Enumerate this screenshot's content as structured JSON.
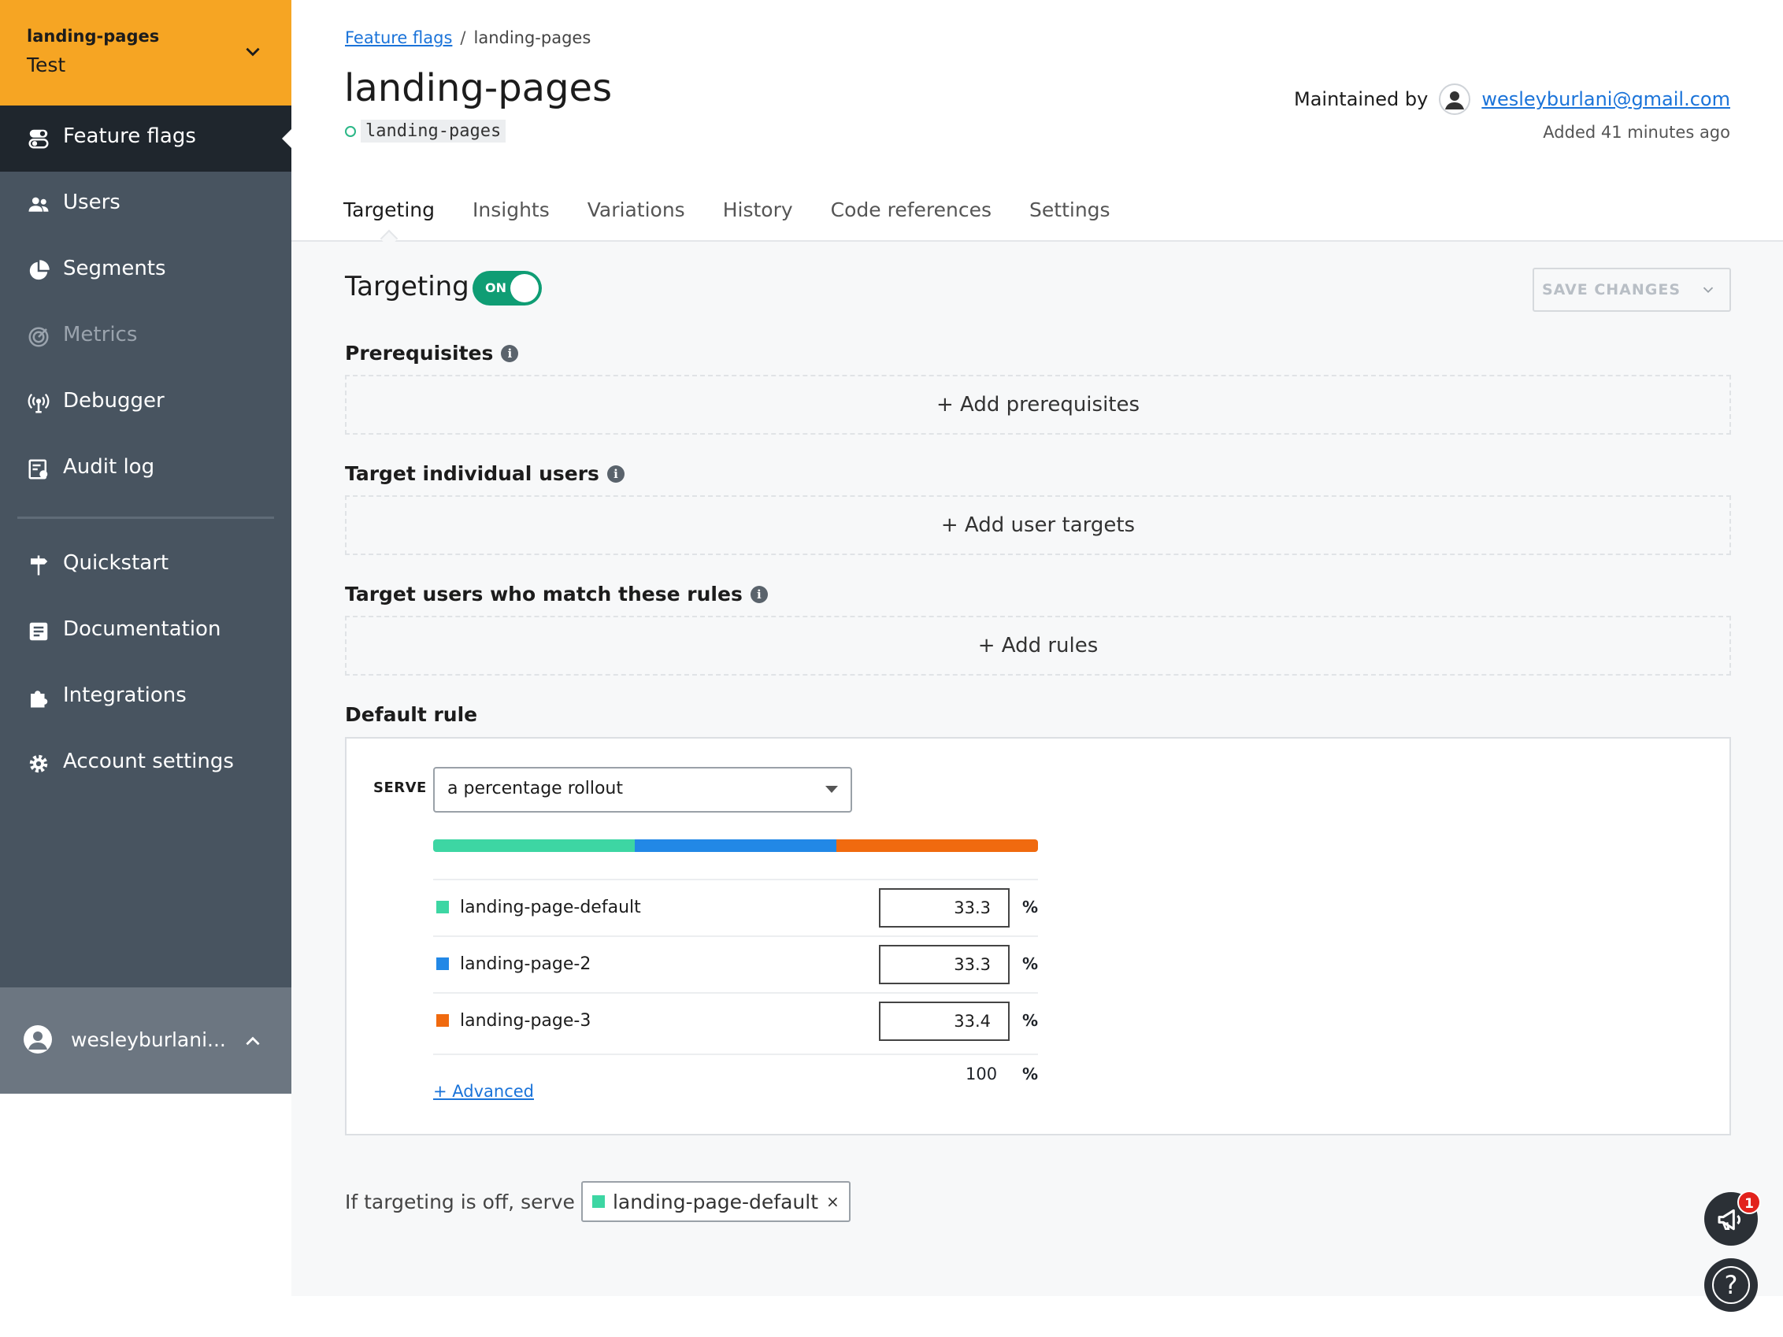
{
  "project": {
    "name": "landing-pages",
    "environment": "Test"
  },
  "sidebar": {
    "items": [
      {
        "label": "Feature flags",
        "icon": "toggle-icon"
      },
      {
        "label": "Users",
        "icon": "users-icon"
      },
      {
        "label": "Segments",
        "icon": "pie-chart-icon"
      },
      {
        "label": "Metrics",
        "icon": "target-icon"
      },
      {
        "label": "Debugger",
        "icon": "broadcast-icon"
      },
      {
        "label": "Audit log",
        "icon": "audit-log-icon"
      },
      {
        "label": "Quickstart",
        "icon": "signpost-icon"
      },
      {
        "label": "Documentation",
        "icon": "document-icon"
      },
      {
        "label": "Integrations",
        "icon": "puzzle-icon"
      },
      {
        "label": "Account settings",
        "icon": "gear-icon"
      }
    ],
    "user": {
      "name": "wesleyburlani..."
    }
  },
  "breadcrumb": {
    "parent": "Feature flags",
    "separator": "/",
    "current": "landing-pages"
  },
  "flag": {
    "title": "landing-pages",
    "key": "landing-pages",
    "maintained_by_label": "Maintained by",
    "maintainer": "wesleyburlani@gmail.com",
    "added": "Added 41 minutes ago"
  },
  "tabs": [
    "Targeting",
    "Insights",
    "Variations",
    "History",
    "Code references",
    "Settings"
  ],
  "targeting": {
    "title": "Targeting",
    "toggle_label": "ON",
    "save_label": "SAVE CHANGES",
    "prerequisites": {
      "label": "Prerequisites",
      "add": "+ Add prerequisites"
    },
    "individual": {
      "label": "Target individual users",
      "add": "+ Add user targets"
    },
    "rules": {
      "label": "Target users who match these rules",
      "add": "+ Add rules"
    },
    "default_rule": {
      "label": "Default rule",
      "serve_label": "SERVE",
      "serve_value": "a percentage rollout",
      "variations": [
        {
          "name": "landing-page-default",
          "percent": "33.3",
          "color": "#3dd6a3"
        },
        {
          "name": "landing-page-2",
          "percent": "33.3",
          "color": "#2288e6"
        },
        {
          "name": "landing-page-3",
          "percent": "33.4",
          "color": "#f06a0f"
        }
      ],
      "percent_sign": "%",
      "total": "100",
      "advanced": "+ Advanced"
    },
    "off_serve": {
      "label": "If targeting is off, serve",
      "variation": "landing-page-default",
      "remove": "×"
    }
  },
  "fabs": {
    "announcement_count": "1",
    "help": "?"
  }
}
